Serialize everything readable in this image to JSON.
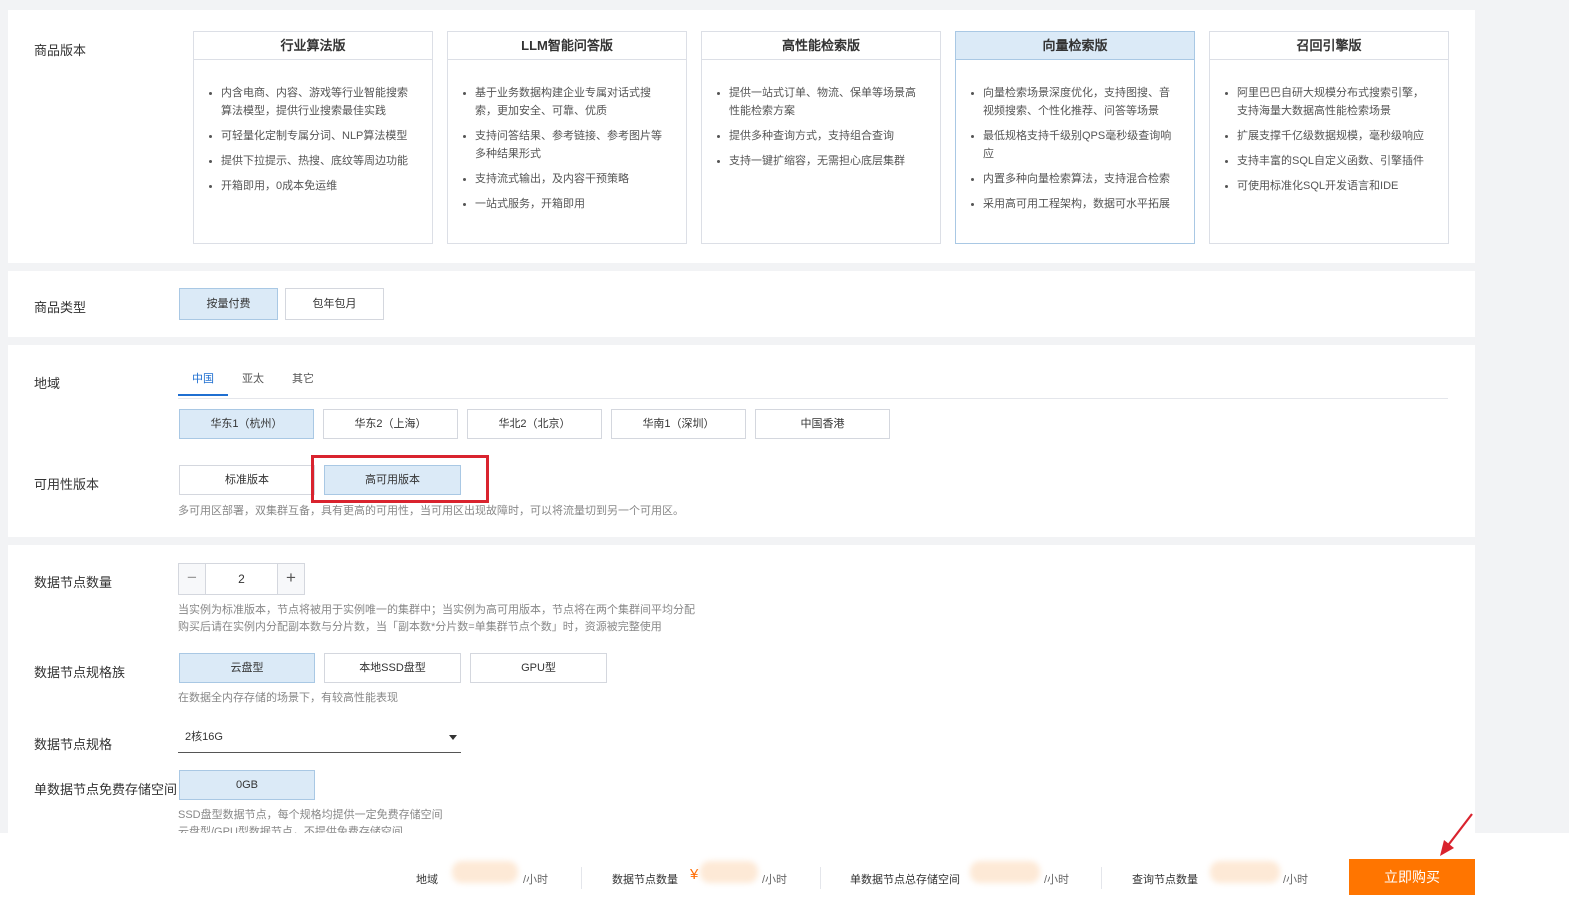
{
  "editions": {
    "label": "商品版本",
    "cards": [
      {
        "title": "行业算法版",
        "features": [
          "内含电商、内容、游戏等行业智能搜索算法模型，提供行业搜索最佳实践",
          "可轻量化定制专属分词、NLP算法模型",
          "提供下拉提示、热搜、底纹等周边功能",
          "开箱即用，0成本免运维"
        ]
      },
      {
        "title": "LLM智能问答版",
        "features": [
          "基于业务数据构建企业专属对话式搜索，更加安全、可靠、优质",
          "支持问答结果、参考链接、参考图片等多种结果形式",
          "支持流式输出，及内容干预策略",
          "一站式服务，开箱即用"
        ]
      },
      {
        "title": "高性能检索版",
        "features": [
          "提供一站式订单、物流、保单等场景高性能检索方案",
          "提供多种查询方式，支持组合查询",
          "支持一键扩缩容，无需担心底层集群"
        ]
      },
      {
        "title": "向量检索版",
        "features": [
          "向量检索场景深度优化，支持图搜、音视频搜索、个性化推荐、问答等场景",
          "最低规格支持千级别QPS毫秒级查询响应",
          "内置多种向量检索算法，支持混合检索",
          "采用高可用工程架构，数据可水平拓展"
        ]
      },
      {
        "title": "召回引擎版",
        "features": [
          "阿里巴巴自研大规模分布式搜索引擎，支持海量大数据高性能检索场景",
          "扩展支撑千亿级数据规模，毫秒级响应",
          "支持丰富的SQL自定义函数、引擎插件",
          "可使用标准化SQL开发语言和IDE"
        ]
      }
    ]
  },
  "product_type": {
    "label": "商品类型",
    "options": [
      "按量付费",
      "包年包月"
    ]
  },
  "region": {
    "label": "地域",
    "tabs": [
      "中国",
      "亚太",
      "其它"
    ],
    "options": [
      "华东1（杭州）",
      "华东2（上海）",
      "华北2（北京）",
      "华南1（深圳）",
      "中国香港"
    ]
  },
  "availability": {
    "label": "可用性版本",
    "options": [
      "标准版本",
      "高可用版本"
    ],
    "hint": "多可用区部署，双集群互备，具有更高的可用性，当可用区出现故障时，可以将流量切到另一个可用区。"
  },
  "nodes": {
    "count_label": "数据节点数量",
    "count_value": "2",
    "minus": "−",
    "plus": "+",
    "count_hint_1": "当实例为标准版本，节点将被用于实例唯一的集群中；当实例为高可用版本，节点将在两个集群间平均分配",
    "count_hint_2": "购买后请在实例内分配副本数与分片数，当「副本数*分片数=单集群节点个数」时，资源被完整使用",
    "family_label": "数据节点规格族",
    "family_options": [
      "云盘型",
      "本地SSD盘型",
      "GPU型"
    ],
    "family_hint": "在数据全内存存储的场景下，有较高性能表现",
    "spec_label": "数据节点规格",
    "spec_value": "2核16G",
    "storage_label": "单数据节点免费存储空间",
    "storage_value": "0GB",
    "storage_hint_1": "SSD盘型数据节点，每个规格均提供一定免费存储空间",
    "storage_hint_2": "云盘型/GPU型数据节点，不提供免费存储空间"
  },
  "summary": {
    "region_label": "地域",
    "node_count_label": "数据节点数量",
    "storage_label": "单数据节点总存储空间",
    "query_nodes_label": "查询节点数量",
    "unit": "/小时",
    "currency": "¥",
    "buy_label": "立即购买"
  },
  "colors": {
    "selected_bg": "#dbeaf7",
    "accent": "#1f6fd1",
    "buy_button": "#ff7500",
    "highlight_box": "#d9232e"
  }
}
